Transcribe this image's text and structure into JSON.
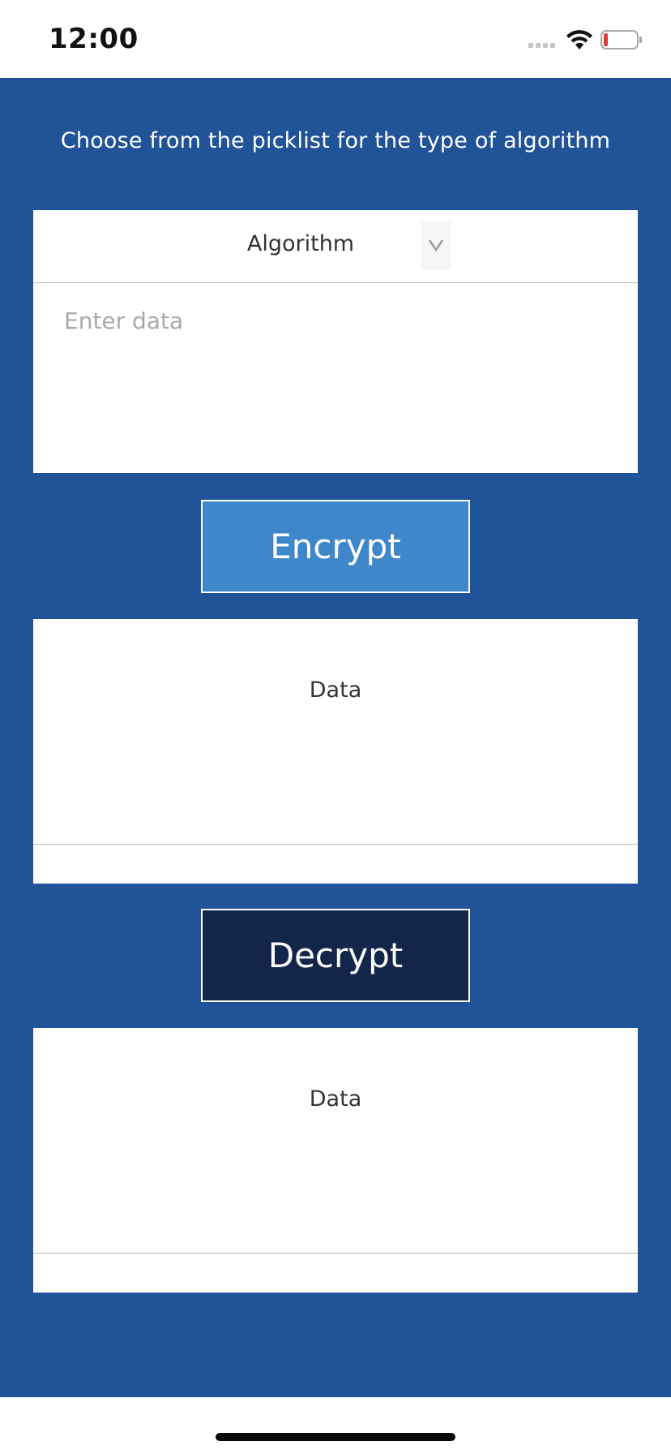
{
  "status_bar": {
    "time": "12:00",
    "battery_color": "#e53935"
  },
  "instruction": {
    "text": "Choose from the picklist for the type of algorithm"
  },
  "algorithm_picker": {
    "selected": "Algorithm"
  },
  "data_input": {
    "value": "",
    "placeholder": "Enter data"
  },
  "encrypt_button": {
    "label": "Encrypt"
  },
  "encrypted_output": {
    "label": "Data"
  },
  "decrypt_button": {
    "label": "Decrypt"
  },
  "decrypted_output": {
    "label": "Data"
  },
  "colors": {
    "background": "#215398",
    "encrypt_button": "#3d87ca",
    "decrypt_button": "#13264a"
  }
}
